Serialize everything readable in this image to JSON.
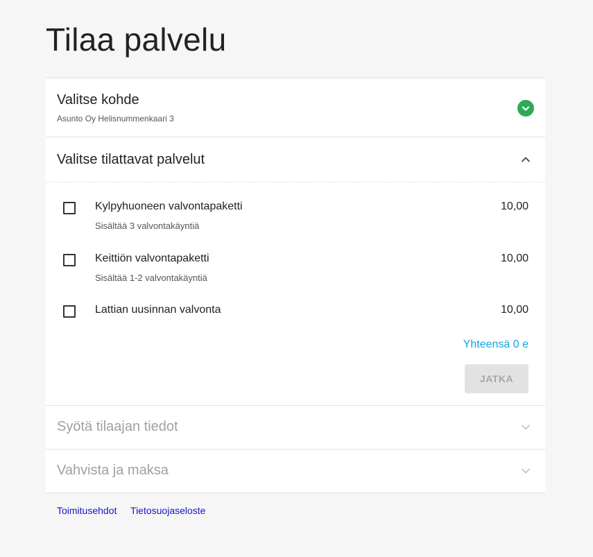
{
  "page": {
    "title": "Tilaa palvelu"
  },
  "steps": {
    "kohde": {
      "title": "Valitse kohde",
      "subtitle": "Asunto Oy Helisnummenkaari 3",
      "status_icon": "check-circle-icon",
      "status_color": "#2eaa57"
    },
    "palvelut": {
      "title": "Valitse tilattavat palvelut",
      "toggle_icon": "chevron-up-icon",
      "services": [
        {
          "name": "Kylpyhuoneen valvontapaketti",
          "description": "Sisältää 3 valvontakäyntiä",
          "price": "10,00",
          "checked": false
        },
        {
          "name": "Keittiön valvontapaketti",
          "description": "Sisältää 1-2 valvontakäyntiä",
          "price": "10,00",
          "checked": false
        },
        {
          "name": "Lattian uusinnan valvonta",
          "description": "",
          "price": "10,00",
          "checked": false
        }
      ],
      "total_label": "Yhteensä 0 e",
      "total_color": "#11a6dc",
      "continue_label": "JATKA",
      "continue_disabled": true
    },
    "tilaaja": {
      "title": "Syötä tilaajan tiedot",
      "toggle_icon": "chevron-down-icon"
    },
    "maksu": {
      "title": "Vahvista ja maksa",
      "toggle_icon": "chevron-down-icon"
    }
  },
  "footer": {
    "links": [
      "Toimitusehdot",
      "Tietosuojaseloste"
    ],
    "link_color": "#1616c8"
  }
}
